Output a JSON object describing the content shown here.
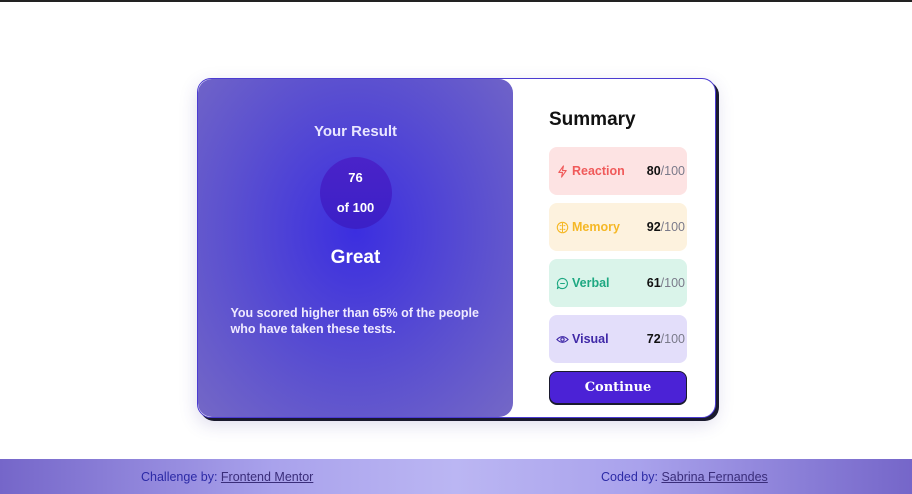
{
  "result": {
    "title": "Your Result",
    "score": "76",
    "of_label": "of 100",
    "grade": "Great",
    "description": "You scored higher than 65% of the people who have taken these tests."
  },
  "summary": {
    "title": "Summary",
    "items": [
      {
        "label": "Reaction",
        "score": "80",
        "max": "/100",
        "icon": "lightning-icon",
        "bg": "#fde3e3",
        "fg": "#f05a5a"
      },
      {
        "label": "Memory",
        "score": "92",
        "max": "/100",
        "icon": "brain-icon",
        "bg": "#fdf2de",
        "fg": "#f5b826"
      },
      {
        "label": "Verbal",
        "score": "61",
        "max": "/100",
        "icon": "chat-bubble-icon",
        "bg": "#daf4ea",
        "fg": "#1ea882"
      },
      {
        "label": "Visual",
        "score": "72",
        "max": "/100",
        "icon": "eye-icon",
        "bg": "#e3defa",
        "fg": "#3f28a7"
      }
    ],
    "continue_label": "Continue"
  },
  "footer": {
    "challenge_prefix": "Challenge by: ",
    "challenge_link": "Frontend Mentor",
    "coded_prefix": "Coded by: ",
    "coded_link": "Sabrina Fernandes"
  }
}
